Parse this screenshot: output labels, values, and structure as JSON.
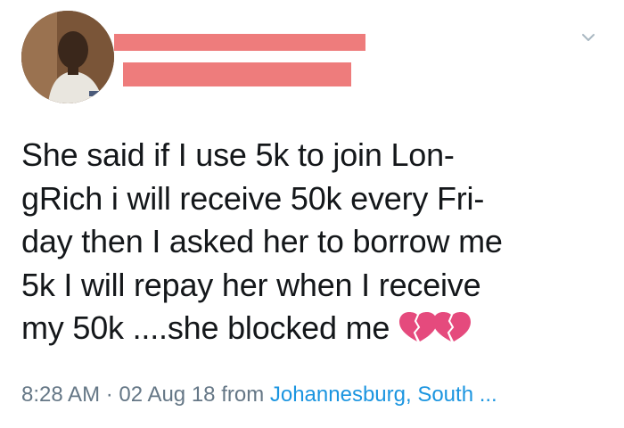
{
  "tweet": {
    "text_lines": [
      "She said if I use 5k to join Lon-",
      "gRich i will receive 50k every Fri-",
      "day then I asked her to borrow me",
      "5k I will repay her when I receive",
      "my 50k ....she blocked me"
    ],
    "emoji": "broken-heart-icon",
    "time": "8:28 AM",
    "separator": "·",
    "date": "02 Aug 18",
    "from_label": "from",
    "location": "Johannesburg, South ..."
  },
  "colors": {
    "redaction": "#ee7c7c",
    "link": "#1b95e0",
    "meta": "#657786",
    "text": "#14171a"
  }
}
